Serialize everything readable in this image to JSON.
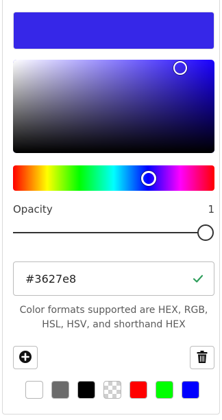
{
  "color": {
    "hex_value": "#3627e8",
    "preview_color": "#3627e8",
    "base_hue_color": "#1a00ff",
    "saturation": 0.83,
    "brightness": 0.91,
    "hue_fraction": 0.675,
    "opacity": 1
  },
  "opacity": {
    "label": "Opacity",
    "value": "1"
  },
  "hex_input": {
    "valid_icon": "check-icon",
    "valid_color": "#2e9e5b"
  },
  "help_text": "Color formats supported are HEX, RGB, HSL, HSV, and shorthand HEX",
  "actions": {
    "add_icon": "plus-circle-icon",
    "delete_icon": "trash-icon"
  },
  "swatches": [
    {
      "name": "white",
      "color": "#ffffff"
    },
    {
      "name": "gray",
      "color": "#6b6b6b"
    },
    {
      "name": "black",
      "color": "#000000"
    },
    {
      "name": "transparent",
      "color": "transparent"
    },
    {
      "name": "red",
      "color": "#ff0000"
    },
    {
      "name": "green",
      "color": "#00ff00"
    },
    {
      "name": "blue",
      "color": "#0000ff"
    }
  ]
}
